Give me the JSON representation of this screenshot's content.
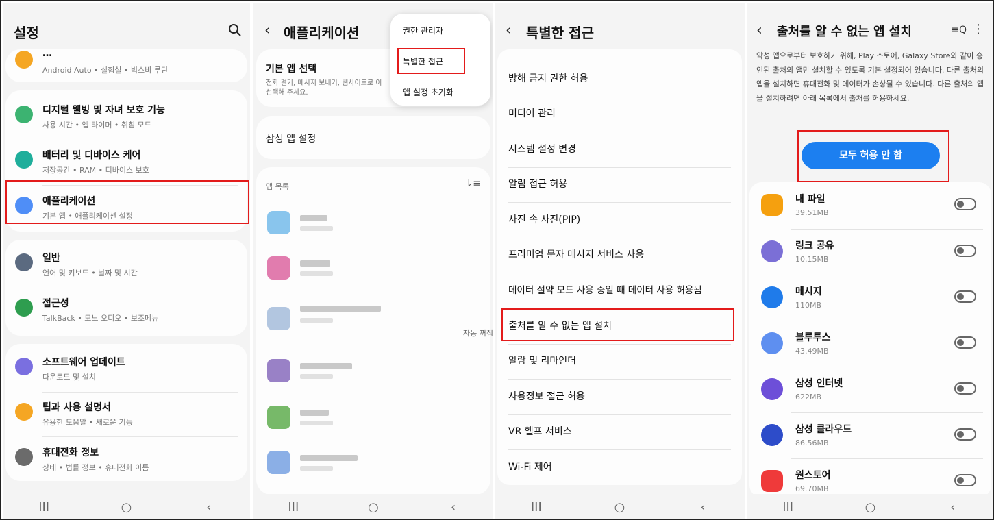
{
  "settings": {
    "title": "설정",
    "items": [
      {
        "title": "…",
        "sub": "Android Auto • 실험실 • 빅스비 루틴"
      },
      {
        "title": "디지털 웰빙 및 자녀 보호 기능",
        "sub": "사용 시간 • 앱 타이머 • 취침 모드"
      },
      {
        "title": "배터리 및 디바이스 케어",
        "sub": "저장공간 • RAM • 디바이스 보호"
      },
      {
        "title": "애플리케이션",
        "sub": "기본 앱 • 애플리케이션 설정"
      },
      {
        "title": "일반",
        "sub": "언어 및 키보드 • 날짜 및 시간"
      },
      {
        "title": "접근성",
        "sub": "TalkBack • 모노 오디오 • 보조메뉴"
      },
      {
        "title": "소프트웨어 업데이트",
        "sub": "다운로드 및 설치"
      },
      {
        "title": "팁과 사용 설명서",
        "sub": "유용한 도움말 • 새로운 기능"
      },
      {
        "title": "휴대전화 정보",
        "sub": "상태 • 법률 정보 • 휴대전화 이름"
      }
    ]
  },
  "apps": {
    "title": "애플리케이션",
    "default_app": {
      "title": "기본 앱 선택",
      "sub1": "전화 걸기, 메시지 보내기, 웹사이트로 이",
      "sub2": "선택해 주세요."
    },
    "samsung_settings": "삼성 앱 설정",
    "list_label": "앱 목록",
    "auto_off": "자동 꺼짐",
    "menu": [
      "권한 관리자",
      "특별한 접근",
      "앱 설정 초기화"
    ]
  },
  "special": {
    "title": "특별한 접근",
    "items": [
      "방해 금지 권한 허용",
      "미디어 관리",
      "시스템 설정 변경",
      "알림 접근 허용",
      "사진 속 사진(PIP)",
      "프리미엄 문자 메시지 서비스 사용",
      "데이터 절약 모드 사용 중일 때 데이터 사용 허용됨",
      "출처를 알 수 없는 앱 설치",
      "알람 및 리마인더",
      "사용정보 접근 허용",
      "VR 헬프 서비스",
      "Wi-Fi 제어"
    ]
  },
  "unknown": {
    "title": "출처를 알 수 없는 앱 설치",
    "desc": "악성 앱으로부터 보호하기 위해, Play 스토어, Galaxy Store와 같이 승인된 출처의 앱만 설치할 수 있도록 기본 설정되어 있습니다. 다른 출처의 앱을 설치하면 휴대전화 및 데이터가 손상될 수 있습니다. 다른 출처의 앱을 설치하려면 아래 목록에서 출처를 허용하세요.",
    "button": "모두 허용 안 함",
    "apps": [
      {
        "name": "내 파일",
        "size": "39.51MB",
        "color": "#f5a00f"
      },
      {
        "name": "링크 공유",
        "size": "10.15MB",
        "color": "#7b6fd6"
      },
      {
        "name": "메시지",
        "size": "110MB",
        "color": "#1f7bea"
      },
      {
        "name": "블루투스",
        "size": "43.49MB",
        "color": "#5e8ff0"
      },
      {
        "name": "삼성 인터넷",
        "size": "622MB",
        "color": "#6d4fd8"
      },
      {
        "name": "삼성 클라우드",
        "size": "86.56MB",
        "color": "#2d4cc9"
      },
      {
        "name": "원스토어",
        "size": "69.70MB",
        "color": "#ef3a3a"
      }
    ]
  },
  "nav": {
    "recent": "III",
    "home": "○",
    "back": "‹"
  }
}
